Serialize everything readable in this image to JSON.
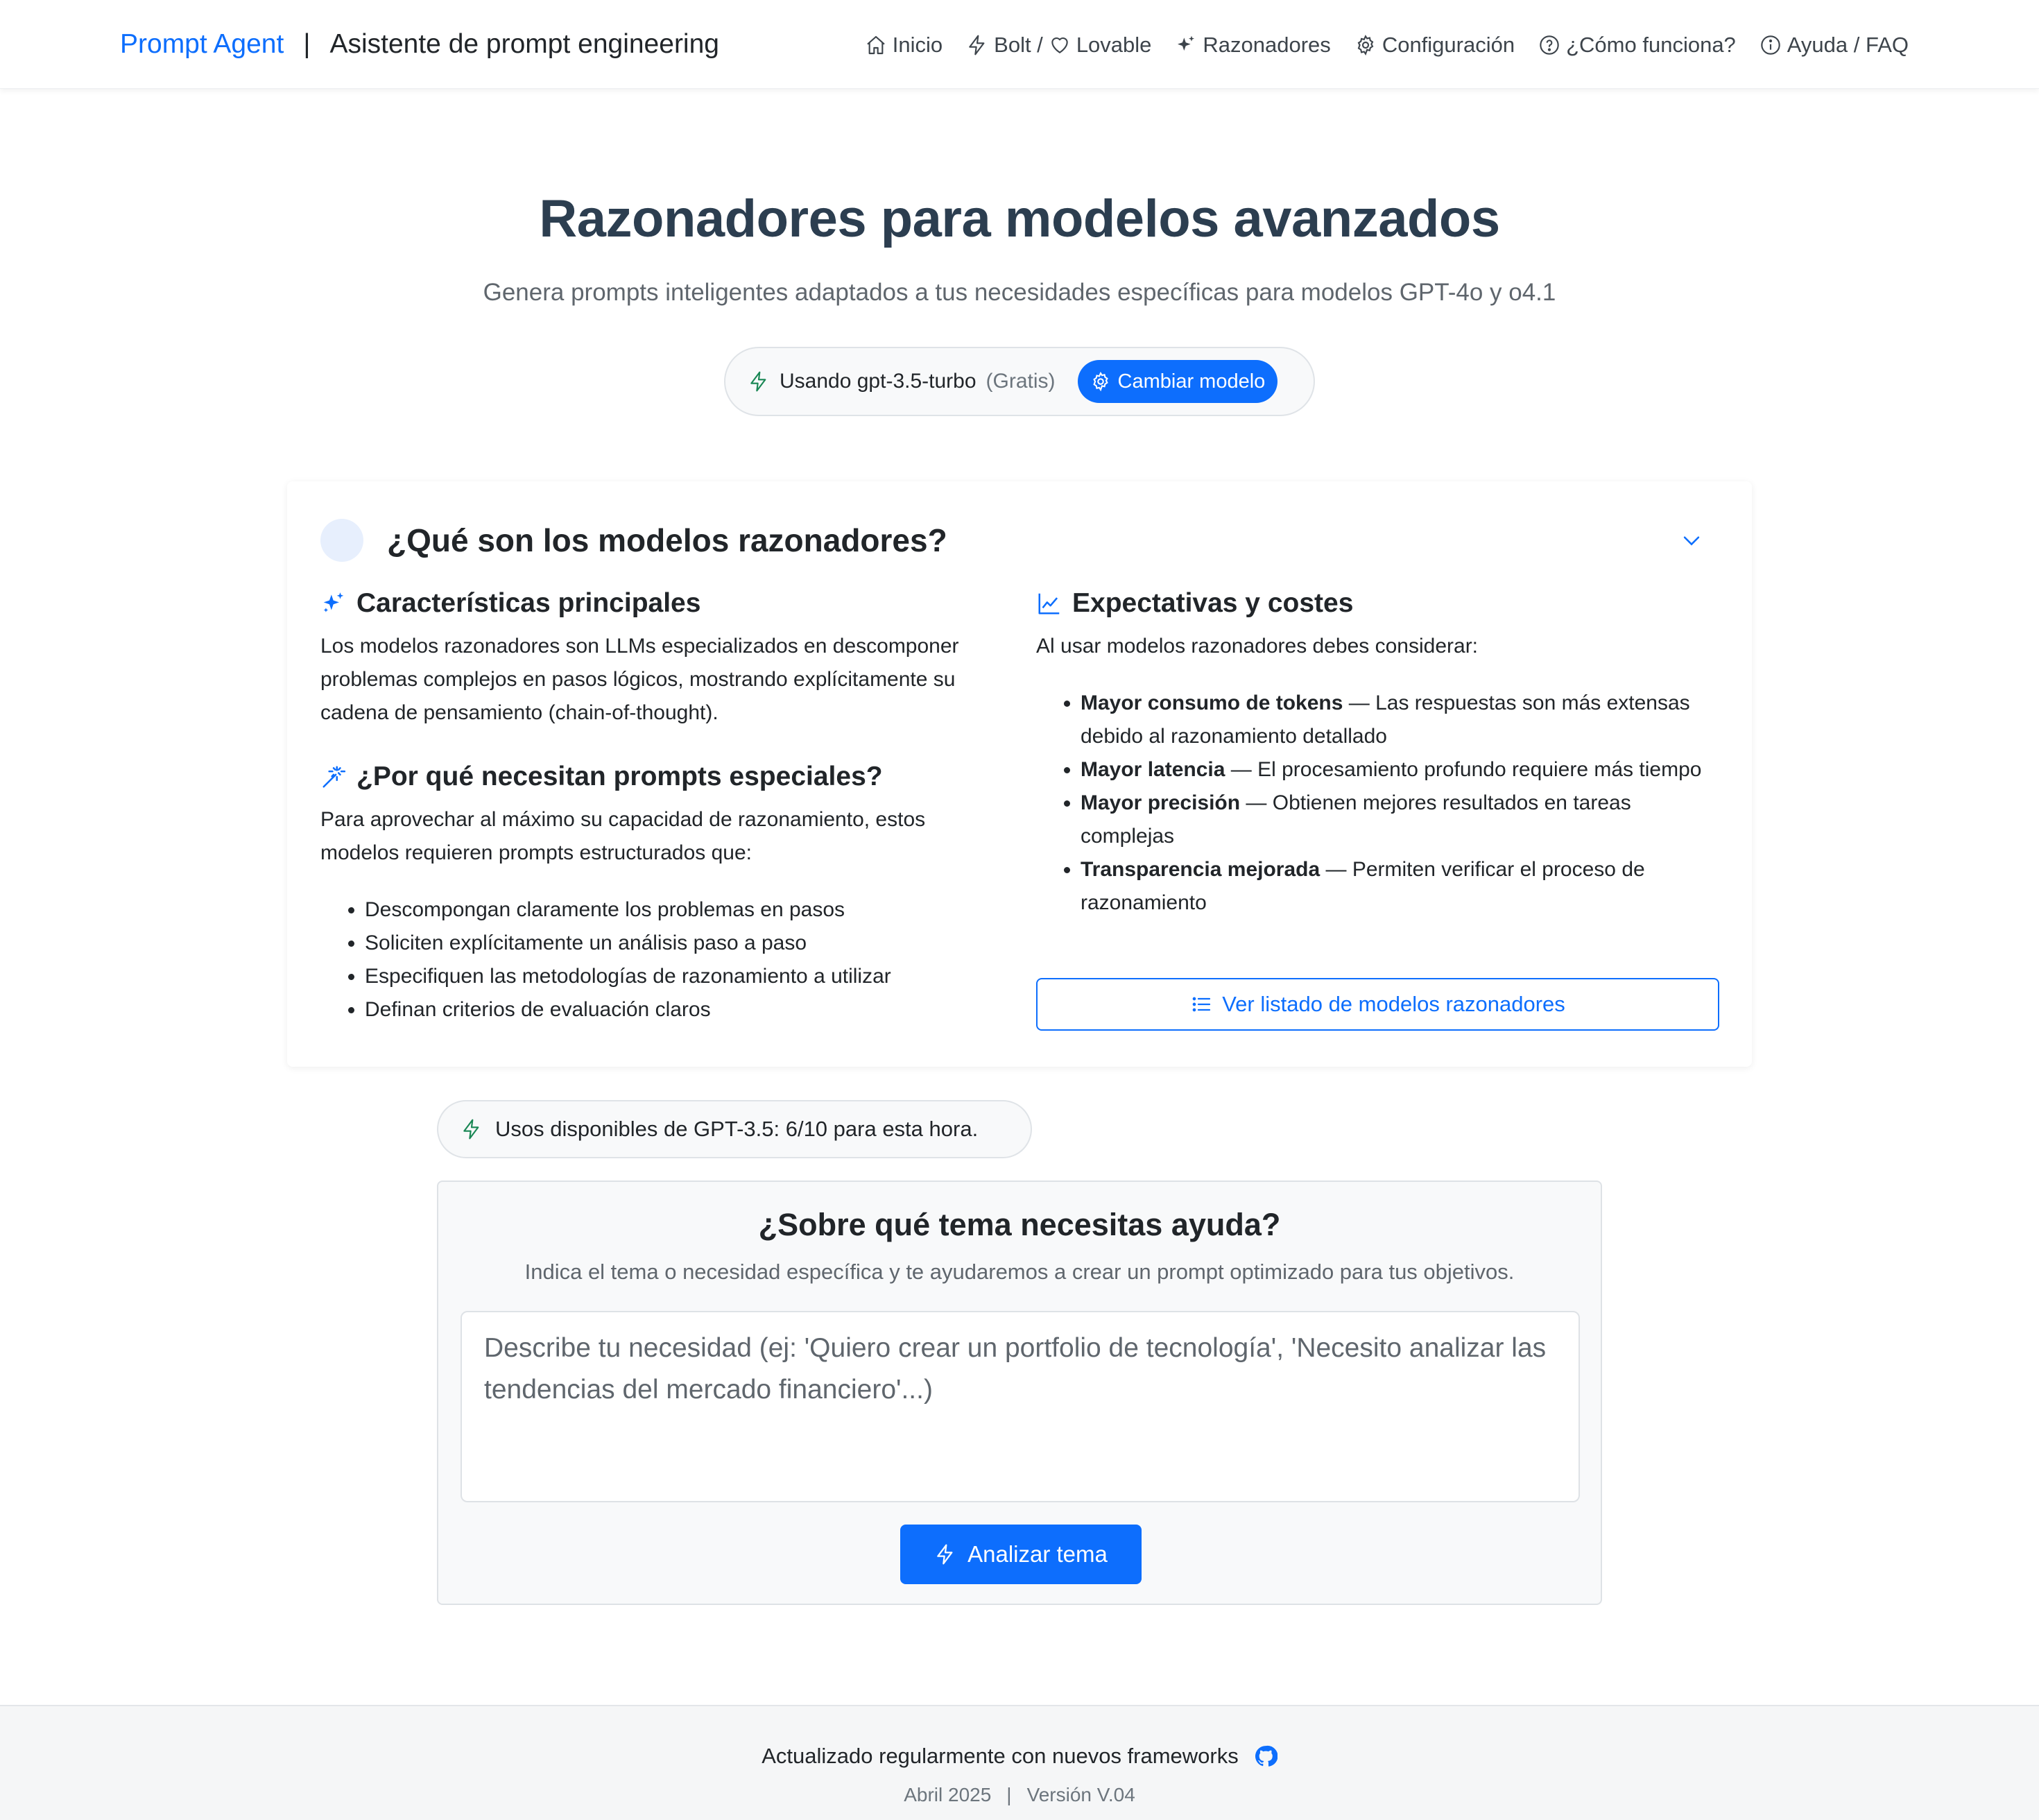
{
  "header": {
    "brand": "Prompt Agent",
    "separator": "|",
    "subtitle": "Asistente de prompt engineering",
    "nav": [
      {
        "label": "Inicio",
        "icon": "home-icon"
      },
      {
        "label": "Bolt /",
        "icon": "bolt-icon"
      },
      {
        "label": "Lovable",
        "icon": "heart-icon"
      },
      {
        "label": "Razonadores",
        "icon": "sparkles-icon"
      },
      {
        "label": "Configuración",
        "icon": "gear-icon"
      },
      {
        "label": "¿Cómo funciona?",
        "icon": "question-circle-icon"
      },
      {
        "label": "Ayuda / FAQ",
        "icon": "info-circle-icon"
      }
    ]
  },
  "hero": {
    "title": "Razonadores para modelos avanzados",
    "subtitle": "Genera prompts inteligentes adaptados a tus necesidades específicas para modelos GPT-4o y o4.1",
    "model_prefix": "Usando",
    "model_name": "gpt-3.5-turbo",
    "model_tier": "(Gratis)",
    "change_model_label": "Cambiar modelo"
  },
  "info": {
    "title": "¿Qué son los modelos razonadores?",
    "left": {
      "features_title": "Características principales",
      "features_text": "Los modelos razonadores son LLMs especializados en descomponer problemas complejos en pasos lógicos, mostrando explícitamente su cadena de pensamiento (chain-of-thought).",
      "why_title": "¿Por qué necesitan prompts especiales?",
      "why_text": "Para aprovechar al máximo su capacidad de razonamiento, estos modelos requieren prompts estructurados que:",
      "why_items": [
        "Descompongan claramente los problemas en pasos",
        "Soliciten explícitamente un análisis paso a paso",
        "Especifiquen las metodologías de razonamiento a utilizar",
        "Definan criterios de evaluación claros"
      ]
    },
    "right": {
      "title": "Expectativas y costes",
      "intro": "Al usar modelos razonadores debes considerar:",
      "items": [
        {
          "bold": "Mayor consumo de tokens",
          "text": " — Las respuestas son más extensas debido al razonamiento detallado"
        },
        {
          "bold": "Mayor latencia",
          "text": " — El procesamiento profundo requiere más tiempo"
        },
        {
          "bold": "Mayor precisión",
          "text": " — Obtienen mejores resultados en tareas complejas"
        },
        {
          "bold": "Transparencia mejorada",
          "text": " — Permiten verificar el proceso de razonamiento"
        }
      ],
      "button_label": "Ver listado de modelos razonadores"
    }
  },
  "usage": {
    "text": "Usos disponibles de GPT-3.5: 6/10 para esta hora."
  },
  "form": {
    "title": "¿Sobre qué tema necesitas ayuda?",
    "subtitle": "Indica el tema o necesidad específica y te ayudaremos a crear un prompt optimizado para tus objetivos.",
    "placeholder": "Describe tu necesidad (ej: 'Quiero crear un portfolio de tecnología', 'Necesito analizar las tendencias del mercado financiero'...)",
    "value": "",
    "submit_label": "Analizar tema"
  },
  "footer": {
    "line1": "Actualizado regularmente con nuevos frameworks",
    "date": "Abril 2025",
    "separator": "|",
    "version": "Versión V.04"
  },
  "colors": {
    "primary": "#0d6efd",
    "heading": "#2c3e50",
    "bolt_green": "#198754",
    "muted": "#6c757d"
  }
}
